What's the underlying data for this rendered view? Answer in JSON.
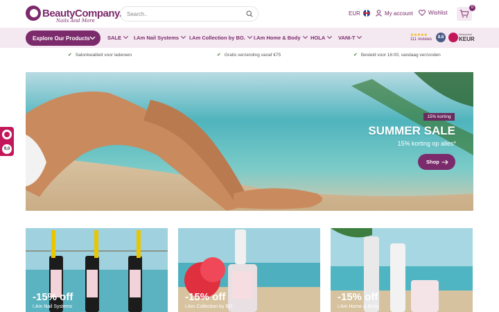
{
  "brand": {
    "name": "BeautyCompany.",
    "tagline": "Nails And More"
  },
  "search": {
    "placeholder": "Search.."
  },
  "header": {
    "currency": "EUR",
    "account_label": "My account",
    "wishlist_label": "Wishlist",
    "cart_count": "0"
  },
  "nav": {
    "explore_label": "Explore Our Products",
    "items": [
      {
        "label": "SALE"
      },
      {
        "label": "I.Am Nail Systems"
      },
      {
        "label": "I.Am Collection by BO."
      },
      {
        "label": "I.Am Home & Body"
      },
      {
        "label": "HOLA"
      },
      {
        "label": "VANI-T"
      }
    ]
  },
  "trust": {
    "stars": "★★★★★",
    "reviews": "111 reviews",
    "score": "8.8",
    "keur_small": "Webwinkel",
    "keur_word": "KEUR"
  },
  "usps": [
    {
      "text": "Salonkwaliteit voor iedereen"
    },
    {
      "text": "Gratis verzending vanaf €75"
    },
    {
      "text": "Besteld voor 16:00, vandaag verzonden"
    }
  ],
  "hero": {
    "badge": "15% korting",
    "title": "SUMMER SALE",
    "subtitle": "15% korting op alles*",
    "cta": "Shop"
  },
  "side_widget": {
    "score": "9,0"
  },
  "cards": [
    {
      "discount": "-15% off",
      "label": "I.Am Nail Systems"
    },
    {
      "discount": "-15% off",
      "label": "I.Am Collection by BO."
    },
    {
      "discount": "-15% off",
      "label": "I.Am Home & Body"
    }
  ],
  "colors": {
    "brand": "#7b2a6b",
    "nav_bg": "#f4e8f1",
    "accent_pink": "#c2185b"
  }
}
